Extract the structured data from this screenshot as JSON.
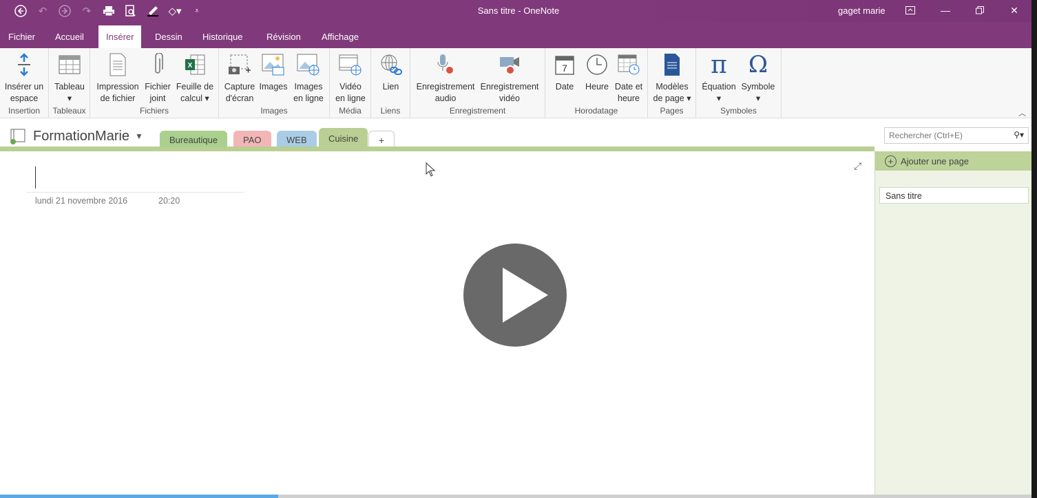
{
  "window": {
    "title": "Sans titre  -  OneNote",
    "user": "gaget marie"
  },
  "qat": [
    "back-icon",
    "undo-icon",
    "redo-icon",
    "redo-icon",
    "print-icon",
    "print-preview-icon",
    "draw-icon",
    "tag-icon",
    "customize-icon"
  ],
  "ribbon_tabs": [
    {
      "label": "Fichier",
      "active": false
    },
    {
      "label": "Accueil",
      "active": false
    },
    {
      "label": "Insérer",
      "active": true
    },
    {
      "label": "Dessin",
      "active": false
    },
    {
      "label": "Historique",
      "active": false
    },
    {
      "label": "Révision",
      "active": false
    },
    {
      "label": "Affichage",
      "active": false
    }
  ],
  "ribbon": {
    "insertion": {
      "label": "Insertion",
      "btn": "Insérer un\nespace"
    },
    "tableaux": {
      "label": "Tableaux",
      "btn": "Tableau\n▾"
    },
    "fichiers": {
      "label": "Fichiers",
      "b1": "Impression\nde fichier",
      "b2": "Fichier\njoint",
      "b3": "Feuille de\ncalcul ▾"
    },
    "images": {
      "label": "Images",
      "b1": "Capture\nd'écran",
      "b2": "Images",
      "b3": "Images\nen ligne"
    },
    "media": {
      "label": "Média",
      "b1": "Vidéo\nen ligne"
    },
    "liens": {
      "label": "Liens",
      "b1": "Lien"
    },
    "enregistrement": {
      "label": "Enregistrement",
      "b1": "Enregistrement\naudio",
      "b2": "Enregistrement\nvidéo"
    },
    "horodatage": {
      "label": "Horodatage",
      "b1": "Date",
      "b2": "Heure",
      "b3": "Date et\nheure"
    },
    "pages": {
      "label": "Pages",
      "b1": "Modèles\nde page ▾"
    },
    "symboles": {
      "label": "Symboles",
      "b1": "Équation\n▾",
      "b2": "Symbole\n▾"
    },
    "colors": {
      "excel": "#1e7145",
      "word": "#2b579a",
      "record": "#d9533f"
    }
  },
  "notebook": {
    "name": "FormationMarie",
    "sections": [
      {
        "label": "Bureautique",
        "color": "#a9d08e"
      },
      {
        "label": "PAO",
        "color": "#f2b6b6"
      },
      {
        "label": "WEB",
        "color": "#a9cde6"
      },
      {
        "label": "Cuisine",
        "color": "#b9cf93"
      }
    ],
    "add_section": "+"
  },
  "search": {
    "placeholder": "Rechercher (Ctrl+E)"
  },
  "page": {
    "date": "lundi 21 novembre 2016",
    "time": "20:20"
  },
  "pagelist": {
    "add_page": "Ajouter une page",
    "pages": [
      "Sans titre"
    ]
  },
  "video": {
    "progress": 0.27
  },
  "colors": {
    "accent": "#80397b",
    "section_green": "#b9cf93",
    "pagelist_bg": "#eef3e5"
  }
}
